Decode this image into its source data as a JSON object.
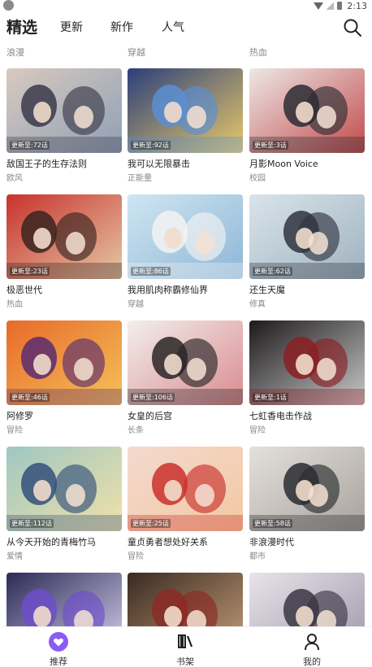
{
  "status_bar": {
    "time": "2:13",
    "icons": [
      "app-icon",
      "wifi-icon",
      "signal-icon",
      "battery-icon"
    ]
  },
  "header": {
    "tabs": [
      {
        "label": "精选",
        "active": true
      },
      {
        "label": "更新",
        "active": false
      },
      {
        "label": "新作",
        "active": false
      },
      {
        "label": "人气",
        "active": false
      }
    ],
    "search_icon": "search-icon"
  },
  "partial_row_genres": [
    "浪漫",
    "穿越",
    "热血"
  ],
  "comics": [
    {
      "title": "敌国王子的生存法则",
      "genre": "欧风",
      "badge": "更新至:72话",
      "colors": [
        "#d8c9bf",
        "#3b3a4a",
        "#8fa0b5"
      ]
    },
    {
      "title": "我可以无限暴击",
      "genre": "正能量",
      "badge": "更新至:92话",
      "colors": [
        "#2b3f7a",
        "#5a8fd4",
        "#e9c96a"
      ]
    },
    {
      "title": "月影Moon Voice",
      "genre": "校园",
      "badge": "更新至:3话",
      "colors": [
        "#ece8e6",
        "#2c2c34",
        "#c24a4a"
      ]
    },
    {
      "title": "极恶世代",
      "genre": "热血",
      "badge": "更新至:23话",
      "colors": [
        "#c8322d",
        "#3a2520",
        "#e6c8a6"
      ]
    },
    {
      "title": "我用肌肉称霸修仙界",
      "genre": "穿越",
      "badge": "更新至:86话",
      "colors": [
        "#cfe6f2",
        "#f3f3f3",
        "#8eb6d6"
      ]
    },
    {
      "title": "还生天魔",
      "genre": "修真",
      "badge": "更新至:62话",
      "colors": [
        "#d9e4ea",
        "#2f3540",
        "#9fb2c0"
      ]
    },
    {
      "title": "阿修罗",
      "genre": "冒险",
      "badge": "更新至:46话",
      "colors": [
        "#e86a2a",
        "#5a2c6e",
        "#f4c25a"
      ]
    },
    {
      "title": "女皇的后宫",
      "genre": "长条",
      "badge": "更新至:106话",
      "colors": [
        "#f2efec",
        "#2a2426",
        "#d98a8f"
      ]
    },
    {
      "title": "七虹香电击作战",
      "genre": "冒险",
      "badge": "更新至:1话",
      "colors": [
        "#1d1a1c",
        "#8b1e23",
        "#c9c9c9"
      ]
    },
    {
      "title": "从今天开始的青梅竹马",
      "genre": "爱情",
      "badge": "更新至:112话",
      "colors": [
        "#9fc7c2",
        "#33507a",
        "#f1e1a8"
      ]
    },
    {
      "title": "童贞勇者想处好关系",
      "genre": "冒险",
      "badge": "更新至:25话",
      "colors": [
        "#f4d9cf",
        "#c9302c",
        "#f2c9a2"
      ]
    },
    {
      "title": "非浪漫时代",
      "genre": "都市",
      "badge": "更新至:58话",
      "colors": [
        "#e4e0dc",
        "#2a2c30",
        "#a8a29c"
      ]
    },
    {
      "title": "",
      "genre": "",
      "badge": "",
      "colors": [
        "#2d2a55",
        "#6d4ec9",
        "#d5d2f0"
      ]
    },
    {
      "title": "",
      "genre": "",
      "badge": "",
      "colors": [
        "#3a2a22",
        "#8c2a24",
        "#c7a07a"
      ]
    },
    {
      "title": "",
      "genre": "",
      "badge": "",
      "colors": [
        "#e8e4ea",
        "#3a3644",
        "#9c96a8"
      ]
    }
  ],
  "bottom_nav": [
    {
      "label": "推荐",
      "icon": "heart-icon",
      "active": true
    },
    {
      "label": "书架",
      "icon": "bookshelf-icon",
      "active": false
    },
    {
      "label": "我的",
      "icon": "person-icon",
      "active": false
    }
  ],
  "accent_color": "#8a5cf5"
}
